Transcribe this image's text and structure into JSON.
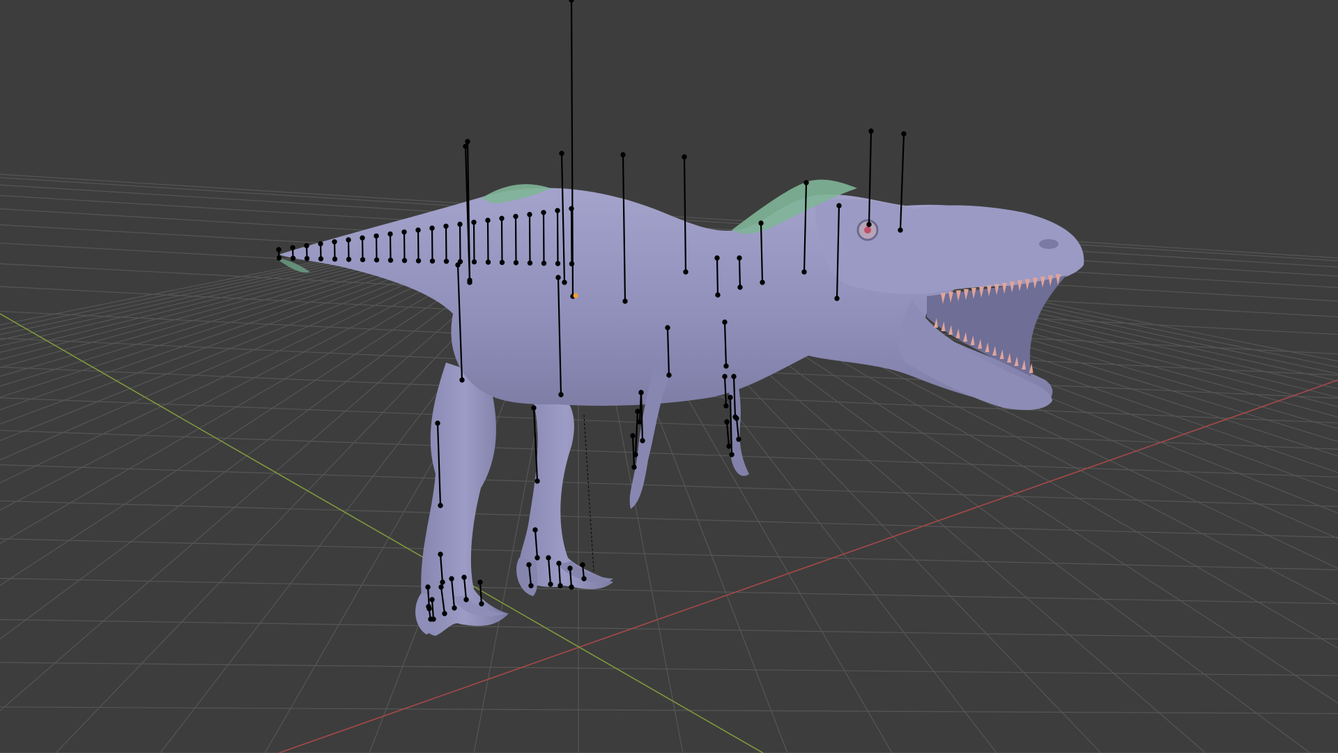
{
  "app": {
    "view": "3D Viewport",
    "background_color": "#3d3d3d"
  },
  "scene": {
    "object": "dinosaur-model",
    "mesh_color": "#8f8fb8",
    "feather_color": "#7fb597",
    "teeth_color": "#e0a49a",
    "bone_color": "#000000",
    "axis_x_color": "#a94848",
    "axis_y_color": "#7d9a3c",
    "grid_color": "#555555",
    "selected_point_color": "#f0a030"
  }
}
